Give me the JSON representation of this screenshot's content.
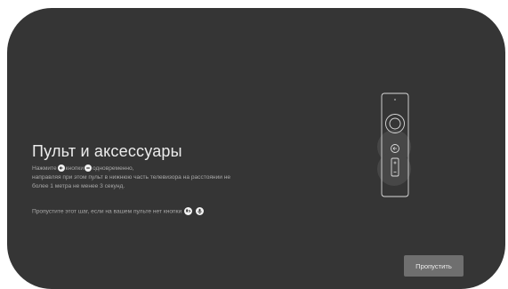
{
  "title": "Пульт и аксессуары",
  "instruction": {
    "press": "Нажмите",
    "buttons_word": "кнопки",
    "simultaneously": "одновременно,",
    "line2": "направляя при этом пульт в нижнюю часть телевизора на расстоянии не",
    "line3": "более 1 метра не менее 3 секунд."
  },
  "skip_note": "Пропустите этот шаг, если на вашем пульте нет кнопки",
  "skip_button": "Пропустить",
  "icons": {
    "back": "back-arrow-icon",
    "minus": "minus-icon",
    "skip_note_1": "voice-search-icon",
    "skip_note_2": "microphone-icon"
  },
  "colors": {
    "background": "#353535",
    "title": "#ececec",
    "body_text": "#a9a9a9",
    "button": "#6f6f6f"
  }
}
